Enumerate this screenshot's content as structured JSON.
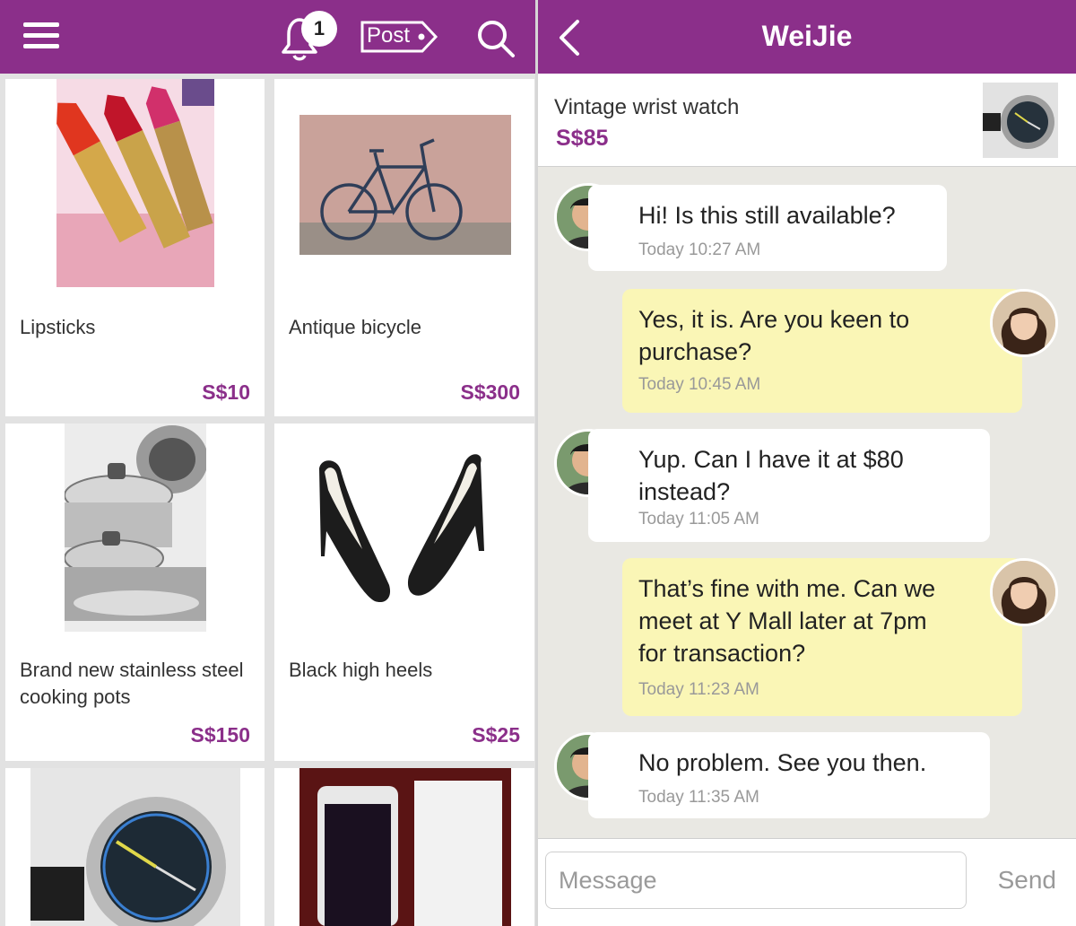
{
  "theme": {
    "accent": "#8b2f8a",
    "sent_bubble": "#faf6b6",
    "received_bubble": "#ffffff",
    "chat_bg": "#e9e8e3"
  },
  "feed": {
    "header": {
      "menu_icon": "hamburger-menu-icon",
      "notification_icon": "bell-icon",
      "notification_count": "1",
      "post_label": "Post",
      "search_icon": "search-icon"
    },
    "listings": [
      {
        "title": "Lipsticks",
        "price": "S$10"
      },
      {
        "title": "Antique bicycle",
        "price": "S$300"
      },
      {
        "title": "Brand new stainless steel cooking pots",
        "price": "S$150"
      },
      {
        "title": "Black high heels",
        "price": "S$25"
      }
    ]
  },
  "chat": {
    "header": {
      "back_icon": "chevron-left-icon",
      "title": "WeiJie"
    },
    "item": {
      "name": "Vintage wrist watch",
      "price": "S$85"
    },
    "messages": [
      {
        "from": "buyer",
        "text": "Hi! Is this still available?",
        "time": "Today 10:27 AM"
      },
      {
        "from": "me",
        "text": "Yes, it is. Are you keen to purchase?",
        "time": "Today 10:45 AM"
      },
      {
        "from": "buyer",
        "text": "Yup. Can I have it at $80 instead?",
        "time": "Today 11:05 AM"
      },
      {
        "from": "me",
        "text": "That’s fine with me. Can we meet at Y Mall later at 7pm for transaction?",
        "time": "Today 11:23 AM"
      },
      {
        "from": "buyer",
        "text": "No problem. See you then.",
        "time": "Today 11:35 AM"
      }
    ],
    "composer": {
      "placeholder": "Message",
      "send_label": "Send"
    }
  }
}
